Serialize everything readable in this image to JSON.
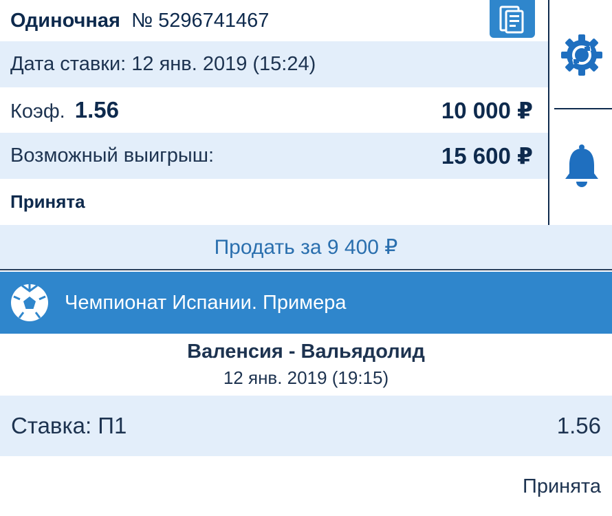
{
  "bet": {
    "type": "Одиночная",
    "number": "№ 5296741467",
    "date_text": "Дата ставки: 12 янв. 2019 (15:24)",
    "coef_label": "Коэф.",
    "coef_value": "1.56",
    "stake": "10 000 ₽",
    "win_label": "Возможный выигрыш:",
    "win_amount": "15 600 ₽",
    "status": "Принята"
  },
  "sell": {
    "label": "Продать за 9 400 ₽"
  },
  "event": {
    "league": "Чемпионат Испании. Примера",
    "teams": "Валенсия - Вальядолид",
    "date": "12 янв. 2019 (19:15)",
    "bet_label": "Ставка: П1",
    "bet_coef": "1.56",
    "status": "Принята"
  },
  "icons": {
    "copy": "copy-icon",
    "settings": "gear-sync-icon",
    "notifications": "bell-icon",
    "sport": "football-icon"
  },
  "colors": {
    "accent": "#2f86cc",
    "light_row": "#e3eefa",
    "text_dark": "#0e2a4d",
    "sell_text": "#2a6fae"
  }
}
